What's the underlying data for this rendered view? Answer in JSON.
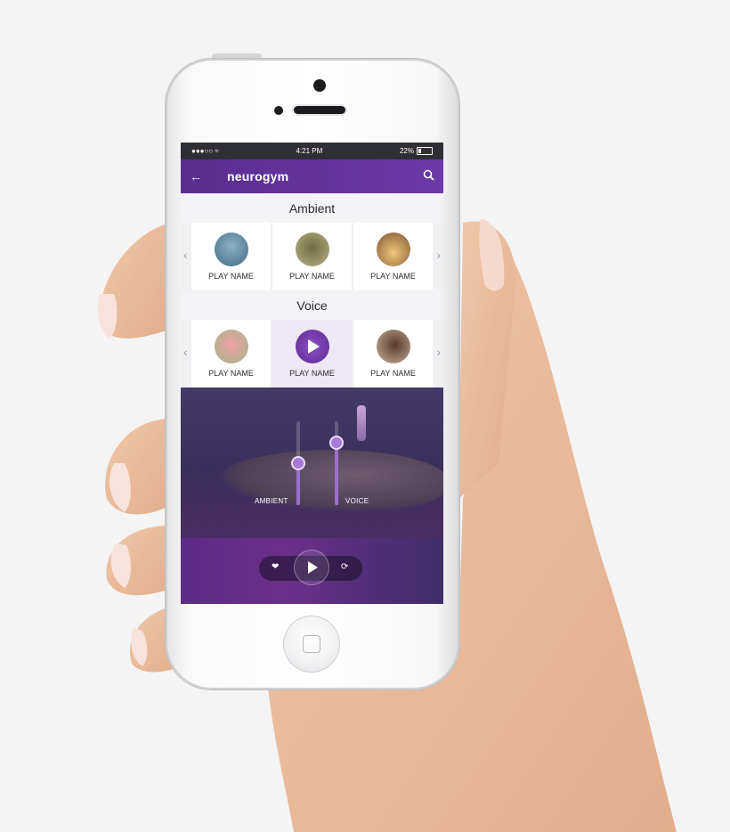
{
  "status": {
    "time": "4:21 PM",
    "battery": "22%"
  },
  "app": {
    "title": "neurogym"
  },
  "sections": [
    {
      "title": "Ambient",
      "items": [
        {
          "label": "PLAY NAME"
        },
        {
          "label": "PLAY NAME"
        },
        {
          "label": "PLAY NAME"
        }
      ]
    },
    {
      "title": "Voice",
      "items": [
        {
          "label": "PLAY NAME"
        },
        {
          "label": "PLAY NAME"
        },
        {
          "label": "PLAY NAME"
        }
      ]
    }
  ],
  "mixer": {
    "ambient_label": "AMBIENT",
    "voice_label": "VOICE",
    "ambient_level": 0.5,
    "voice_level": 0.74
  },
  "icons": {
    "back": "arrow-left-icon",
    "search": "search-icon",
    "favorite": "heart-icon",
    "play": "play-icon",
    "repeat": "repeat-icon"
  },
  "colors": {
    "accent": "#6c3aa8",
    "player": "#5c2c86"
  }
}
